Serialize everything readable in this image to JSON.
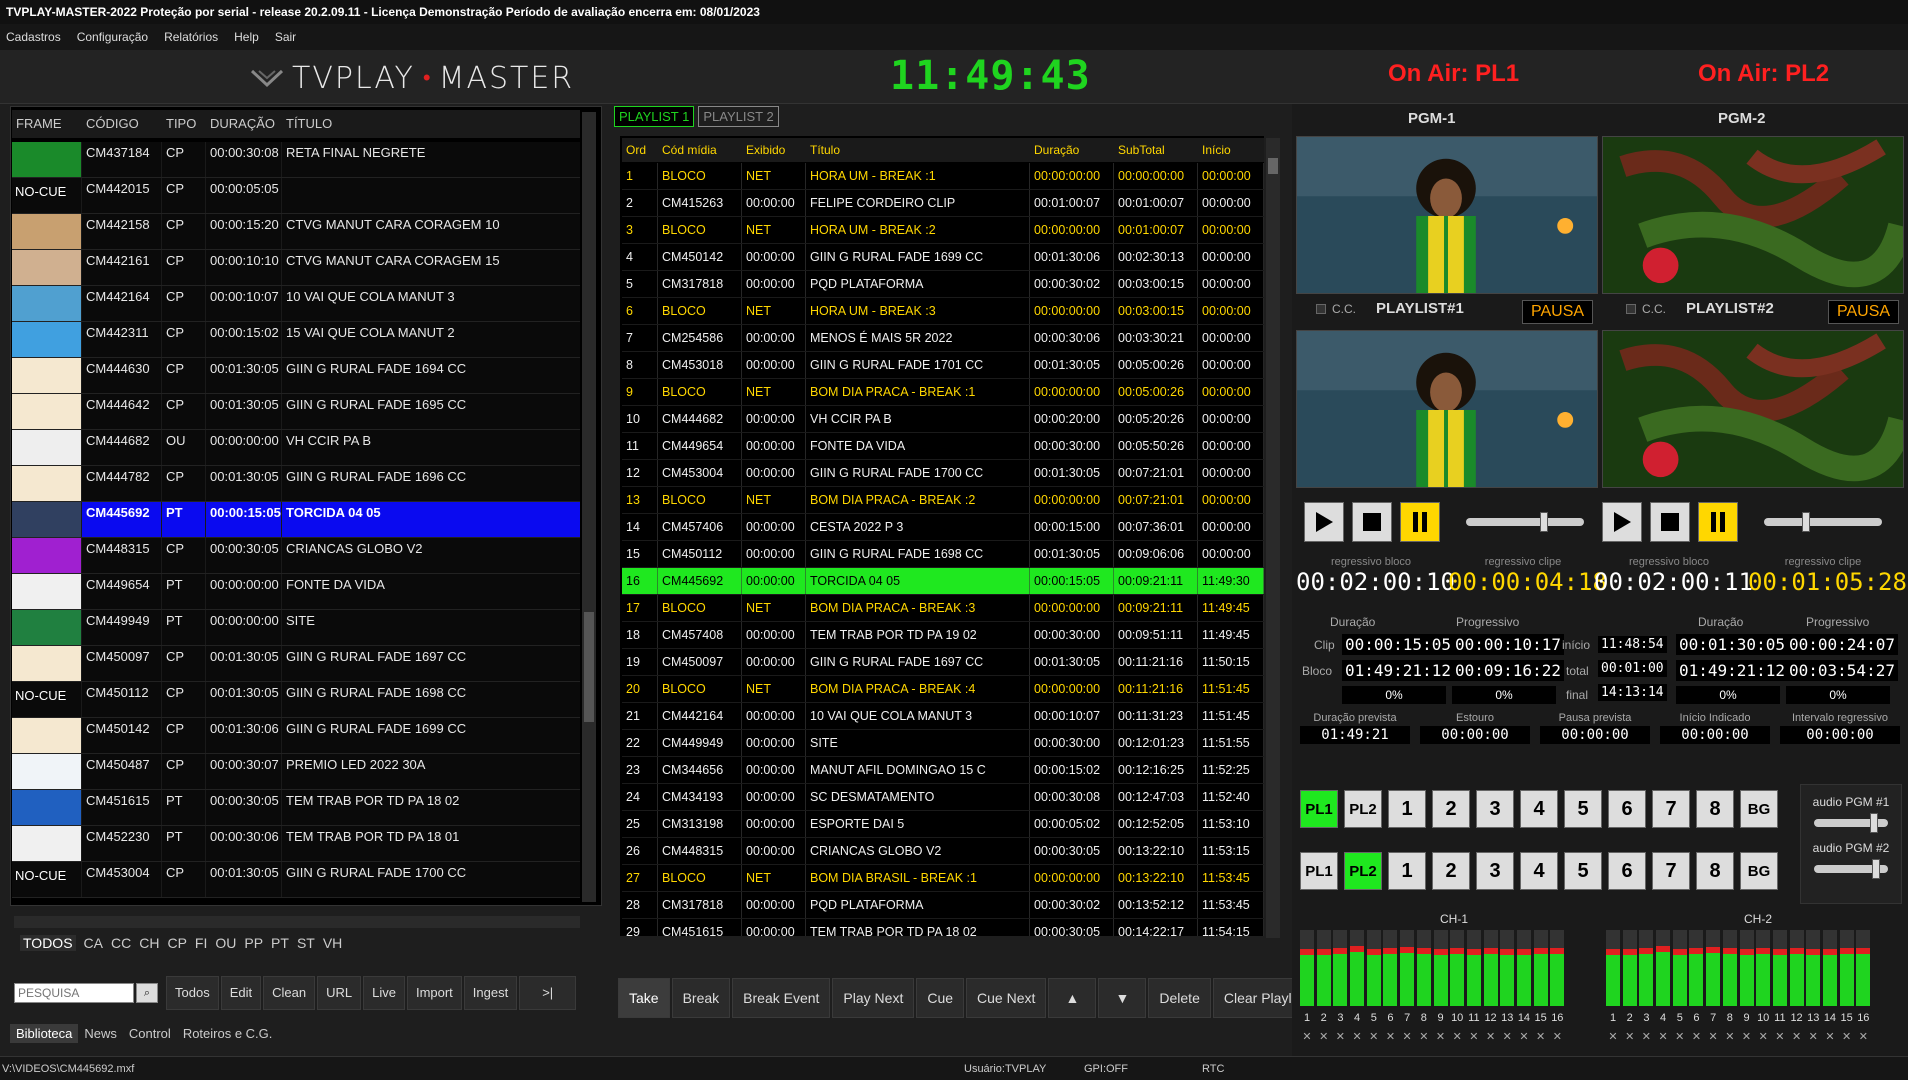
{
  "window": {
    "title": "TVPLAY-MASTER-2022  Proteção por serial    - release 20.2.09.11 - Licença  Demonstração  Período de avaliação encerra em: 08/01/2023"
  },
  "menu": [
    "Cadastros",
    "Configuração",
    "Relatórios",
    "Help",
    "Sair"
  ],
  "header": {
    "brand_left": "TVPLAY",
    "brand_right": "MASTER",
    "clock": "11:49:43",
    "onair1": "On Air: PL1",
    "onair2": "On Air: PL2"
  },
  "library": {
    "columns": [
      "FRAME",
      "CÓDIGO",
      "TIPO",
      "DURAÇÃO",
      "TÍTULO"
    ],
    "rows": [
      {
        "frame": "",
        "code": "CM437184",
        "type": "CP",
        "dur": "00:00:30:08",
        "title": "RETA FINAL NEGRETE",
        "thumb": "#1a8a2a"
      },
      {
        "frame": "NO-CUE",
        "code": "CM442015",
        "type": "CP",
        "dur": "00:00:05:05",
        "title": "",
        "thumb": ""
      },
      {
        "frame": "",
        "code": "CM442158",
        "type": "CP",
        "dur": "00:00:15:20",
        "title": "CTVG MANUT CARA CORAGEM 10",
        "thumb": "#c8a070"
      },
      {
        "frame": "",
        "code": "CM442161",
        "type": "CP",
        "dur": "00:00:10:10",
        "title": "CTVG MANUT CARA CORAGEM 15",
        "thumb": "#d0b090"
      },
      {
        "frame": "",
        "code": "CM442164",
        "type": "CP",
        "dur": "00:00:10:07",
        "title": "10 VAI QUE COLA MANUT 3",
        "thumb": "#50a0d0"
      },
      {
        "frame": "",
        "code": "CM442311",
        "type": "CP",
        "dur": "00:00:15:02",
        "title": "15 VAI QUE COLA MANUT 2",
        "thumb": "#40a0e0"
      },
      {
        "frame": "",
        "code": "CM444630",
        "type": "CP",
        "dur": "00:01:30:05",
        "title": "GIIN G RURAL FADE 1694 CC",
        "thumb": "#f5e8d0"
      },
      {
        "frame": "",
        "code": "CM444642",
        "type": "CP",
        "dur": "00:01:30:05",
        "title": "GIIN G RURAL FADE 1695 CC",
        "thumb": "#f5e8d0"
      },
      {
        "frame": "",
        "code": "CM444682",
        "type": "OU",
        "dur": "00:00:00:00",
        "title": "VH CCIR PA B",
        "thumb": "#eeeeee"
      },
      {
        "frame": "",
        "code": "CM444782",
        "type": "CP",
        "dur": "00:01:30:05",
        "title": "GIIN G RURAL FADE 1696 CC",
        "thumb": "#f5e8d0"
      },
      {
        "frame": "",
        "code": "CM445692",
        "type": "PT",
        "dur": "00:00:15:05",
        "title": "TORCIDA 04 05",
        "thumb": "#304060",
        "sel": true
      },
      {
        "frame": "",
        "code": "CM448315",
        "type": "CP",
        "dur": "00:00:30:05",
        "title": "CRIANCAS GLOBO V2",
        "thumb": "#a020d0"
      },
      {
        "frame": "",
        "code": "CM449654",
        "type": "PT",
        "dur": "00:00:00:00",
        "title": "FONTE DA VIDA",
        "thumb": "#f0f0f0"
      },
      {
        "frame": "",
        "code": "CM449949",
        "type": "PT",
        "dur": "00:00:00:00",
        "title": "SITE",
        "thumb": "#208040"
      },
      {
        "frame": "",
        "code": "CM450097",
        "type": "CP",
        "dur": "00:01:30:05",
        "title": "GIIN G RURAL FADE 1697 CC",
        "thumb": "#f5e8d0"
      },
      {
        "frame": "NO-CUE",
        "code": "CM450112",
        "type": "CP",
        "dur": "00:01:30:05",
        "title": "GIIN G RURAL FADE 1698 CC",
        "thumb": ""
      },
      {
        "frame": "",
        "code": "CM450142",
        "type": "CP",
        "dur": "00:01:30:06",
        "title": "GIIN G RURAL FADE 1699 CC",
        "thumb": "#f5e8d0"
      },
      {
        "frame": "",
        "code": "CM450487",
        "type": "CP",
        "dur": "00:00:30:07",
        "title": "PREMIO LED 2022 30A",
        "thumb": "#f0f4f8"
      },
      {
        "frame": "",
        "code": "CM451615",
        "type": "PT",
        "dur": "00:00:30:05",
        "title": "TEM TRAB POR TD PA 18 02",
        "thumb": "#2060c0"
      },
      {
        "frame": "",
        "code": "CM452230",
        "type": "PT",
        "dur": "00:00:30:06",
        "title": "TEM TRAB POR TD PA 18 01",
        "thumb": "#f0f0f0"
      },
      {
        "frame": "NO-CUE",
        "code": "CM453004",
        "type": "CP",
        "dur": "00:01:30:05",
        "title": "GIIN G RURAL FADE 1700 CC",
        "thumb": ""
      }
    ],
    "categories": [
      "TODOS",
      "CA",
      "CC",
      "CH",
      "CP",
      "FI",
      "OU",
      "PP",
      "PT",
      "ST",
      "VH"
    ],
    "search_placeholder": "PESQUISA",
    "toolbar": [
      "Todos",
      "Edit",
      "Clean",
      "URL",
      "Live",
      "Import",
      "Ingest",
      ">|"
    ],
    "bottom_tabs": [
      "Biblioteca",
      "News",
      "Control",
      "Roteiros e C.G."
    ]
  },
  "playlist": {
    "tabs": [
      "PLAYLIST 1",
      "PLAYLIST 2"
    ],
    "columns": [
      "Ord",
      "Cód mídia",
      "Exibido",
      "Título",
      "Duração",
      "SubTotal",
      "Início"
    ],
    "rows": [
      [
        "1",
        "BLOCO",
        "NET",
        "HORA UM - BREAK :1",
        "00:00:00:00",
        "00:00:00:00",
        "00:00:00",
        "b"
      ],
      [
        "2",
        "CM415263",
        "00:00:00",
        "FELIPE CORDEIRO CLIP",
        "00:01:00:07",
        "00:01:00:07",
        "00:00:00",
        ""
      ],
      [
        "3",
        "BLOCO",
        "NET",
        "HORA UM - BREAK :2",
        "00:00:00:00",
        "00:01:00:07",
        "00:00:00",
        "b"
      ],
      [
        "4",
        "CM450142",
        "00:00:00",
        "GIIN G RURAL FADE 1699 CC",
        "00:01:30:06",
        "00:02:30:13",
        "00:00:00",
        ""
      ],
      [
        "5",
        "CM317818",
        "00:00:00",
        "PQD PLATAFORMA",
        "00:00:30:02",
        "00:03:00:15",
        "00:00:00",
        ""
      ],
      [
        "6",
        "BLOCO",
        "NET",
        "HORA UM - BREAK :3",
        "00:00:00:00",
        "00:03:00:15",
        "00:00:00",
        "b"
      ],
      [
        "7",
        "CM254586",
        "00:00:00",
        "MENOS É MAIS 5R 2022",
        "00:00:30:06",
        "00:03:30:21",
        "00:00:00",
        ""
      ],
      [
        "8",
        "CM453018",
        "00:00:00",
        "GIIN G RURAL FADE 1701 CC",
        "00:01:30:05",
        "00:05:00:26",
        "00:00:00",
        ""
      ],
      [
        "9",
        "BLOCO",
        "NET",
        "BOM DIA PRACA - BREAK :1",
        "00:00:00:00",
        "00:05:00:26",
        "00:00:00",
        "b"
      ],
      [
        "10",
        "CM444682",
        "00:00:00",
        "VH CCIR PA B",
        "00:00:20:00",
        "00:05:20:26",
        "00:00:00",
        ""
      ],
      [
        "11",
        "CM449654",
        "00:00:00",
        "FONTE DA VIDA",
        "00:00:30:00",
        "00:05:50:26",
        "00:00:00",
        ""
      ],
      [
        "12",
        "CM453004",
        "00:00:00",
        "GIIN G RURAL FADE 1700 CC",
        "00:01:30:05",
        "00:07:21:01",
        "00:00:00",
        ""
      ],
      [
        "13",
        "BLOCO",
        "NET",
        "BOM DIA PRACA - BREAK :2",
        "00:00:00:00",
        "00:07:21:01",
        "00:00:00",
        "b"
      ],
      [
        "14",
        "CM457406",
        "00:00:00",
        "CESTA 2022 P 3",
        "00:00:15:00",
        "00:07:36:01",
        "00:00:00",
        ""
      ],
      [
        "15",
        "CM450112",
        "00:00:00",
        "GIIN G RURAL FADE 1698 CC",
        "00:01:30:05",
        "00:09:06:06",
        "00:00:00",
        ""
      ],
      [
        "16",
        "CM445692",
        "00:00:00",
        "TORCIDA 04 05",
        "00:00:15:05",
        "00:09:21:11",
        "11:49:30",
        "c"
      ],
      [
        "17",
        "BLOCO",
        "NET",
        "BOM DIA PRACA - BREAK :3",
        "00:00:00:00",
        "00:09:21:11",
        "11:49:45",
        "b"
      ],
      [
        "18",
        "CM457408",
        "00:00:00",
        "TEM TRAB POR TD PA 19 02",
        "00:00:30:00",
        "00:09:51:11",
        "11:49:45",
        ""
      ],
      [
        "19",
        "CM450097",
        "00:00:00",
        "GIIN G RURAL FADE 1697 CC",
        "00:01:30:05",
        "00:11:21:16",
        "11:50:15",
        ""
      ],
      [
        "20",
        "BLOCO",
        "NET",
        "BOM DIA PRACA - BREAK :4",
        "00:00:00:00",
        "00:11:21:16",
        "11:51:45",
        "b"
      ],
      [
        "21",
        "CM442164",
        "00:00:00",
        "10 VAI QUE COLA MANUT 3",
        "00:00:10:07",
        "00:11:31:23",
        "11:51:45",
        ""
      ],
      [
        "22",
        "CM449949",
        "00:00:00",
        "SITE",
        "00:00:30:00",
        "00:12:01:23",
        "11:51:55",
        ""
      ],
      [
        "23",
        "CM344656",
        "00:00:00",
        "MANUT AFIL DOMINGAO 15 C",
        "00:00:15:02",
        "00:12:16:25",
        "11:52:25",
        ""
      ],
      [
        "24",
        "CM434193",
        "00:00:00",
        "SC DESMATAMENTO",
        "00:00:30:08",
        "00:12:47:03",
        "11:52:40",
        ""
      ],
      [
        "25",
        "CM313198",
        "00:00:00",
        "ESPORTE DAI 5",
        "00:00:05:02",
        "00:12:52:05",
        "11:53:10",
        ""
      ],
      [
        "26",
        "CM448315",
        "00:00:00",
        "CRIANCAS GLOBO V2",
        "00:00:30:05",
        "00:13:22:10",
        "11:53:15",
        ""
      ],
      [
        "27",
        "BLOCO",
        "NET",
        "BOM DIA BRASIL - BREAK :1",
        "00:00:00:00",
        "00:13:22:10",
        "11:53:45",
        "b"
      ],
      [
        "28",
        "CM317818",
        "00:00:00",
        "PQD PLATAFORMA",
        "00:00:30:02",
        "00:13:52:12",
        "11:53:45",
        ""
      ],
      [
        "29",
        "CM451615",
        "00:00:00",
        "TEM TRAB POR TD PA 18 02",
        "00:00:30:05",
        "00:14:22:17",
        "11:54:15",
        ""
      ]
    ],
    "toolbar": [
      "Take",
      "Break",
      "Break Event",
      "Play Next",
      "Cue",
      "Cue Next",
      "▲",
      "▼",
      "Delete",
      "Clear Playlist"
    ]
  },
  "pgm": {
    "pgm1": "PGM-1",
    "pgm2": "PGM-2",
    "cc": "C.C.",
    "pl1_label": "PLAYLIST#1",
    "pl2_label": "PLAYLIST#2",
    "pausa": "PAUSA",
    "t_bloco_lbl": "regressivo bloco",
    "t_clip_lbl": "regressivo clipe",
    "pl1_bloco": "00:02:00:10",
    "pl1_clip": "00:00:04:18",
    "pl2_bloco": "00:02:00:11",
    "pl2_clip": "00:01:05:28",
    "duracao": "Duração",
    "progressivo": "Progressivo",
    "clip": "Clip",
    "bloco": "Bloco",
    "pl1_clip_dur": "00:00:15:05",
    "pl1_clip_prog": "00:00:10:17",
    "pl1_bloco_dur": "01:49:21:12",
    "pl1_bloco_prog": "00:09:16:22",
    "pl1_pct1": "0%",
    "pl1_pct2": "0%",
    "inicio_lbl": "início",
    "total_lbl": "total",
    "final_lbl": "final",
    "inicio": "11:48:54",
    "total": "00:01:00",
    "final": "14:13:14",
    "pl2_clip_dur": "00:01:30:05",
    "pl2_clip_prog": "00:00:24:07",
    "pl2_bloco_dur": "01:49:21:12",
    "pl2_bloco_prog": "00:03:54:27",
    "pl2_pct1": "0%",
    "pl2_pct2": "0%",
    "dur_prev_lbl": "Duração prevista",
    "dur_prev": "01:49:21",
    "estouro_lbl": "Estouro",
    "estouro": "00:00:00",
    "pausa_prev_lbl": "Pausa prevista",
    "pausa_prev": "00:00:00",
    "inicio_ind_lbl": "Início Indicado",
    "inicio_ind": "00:00:00",
    "interv_lbl": "Intervalo regressivo",
    "interv": "00:00:00",
    "sources": [
      "PL1",
      "PL2",
      "1",
      "2",
      "3",
      "4",
      "5",
      "6",
      "7",
      "8",
      "BG"
    ],
    "audio1": "audio PGM #1",
    "audio2": "audio PGM #2",
    "ch1": "CH-1",
    "ch2": "CH-2",
    "channels": [
      "1",
      "2",
      "3",
      "4",
      "5",
      "6",
      "7",
      "8",
      "9",
      "10",
      "11",
      "12",
      "13",
      "14",
      "15",
      "16"
    ],
    "vu_levels": [
      0.72,
      0.72,
      0.74,
      0.76,
      0.72,
      0.74,
      0.75,
      0.74,
      0.73,
      0.74,
      0.72,
      0.74,
      0.72,
      0.73,
      0.74,
      0.74
    ],
    "mute_glyph": "✕"
  },
  "status": {
    "path": "V:\\VIDEOS\\CM445692.mxf",
    "user": "Usuário:TVPLAY",
    "gpi": "GPI:OFF",
    "rtc": "RTC"
  }
}
